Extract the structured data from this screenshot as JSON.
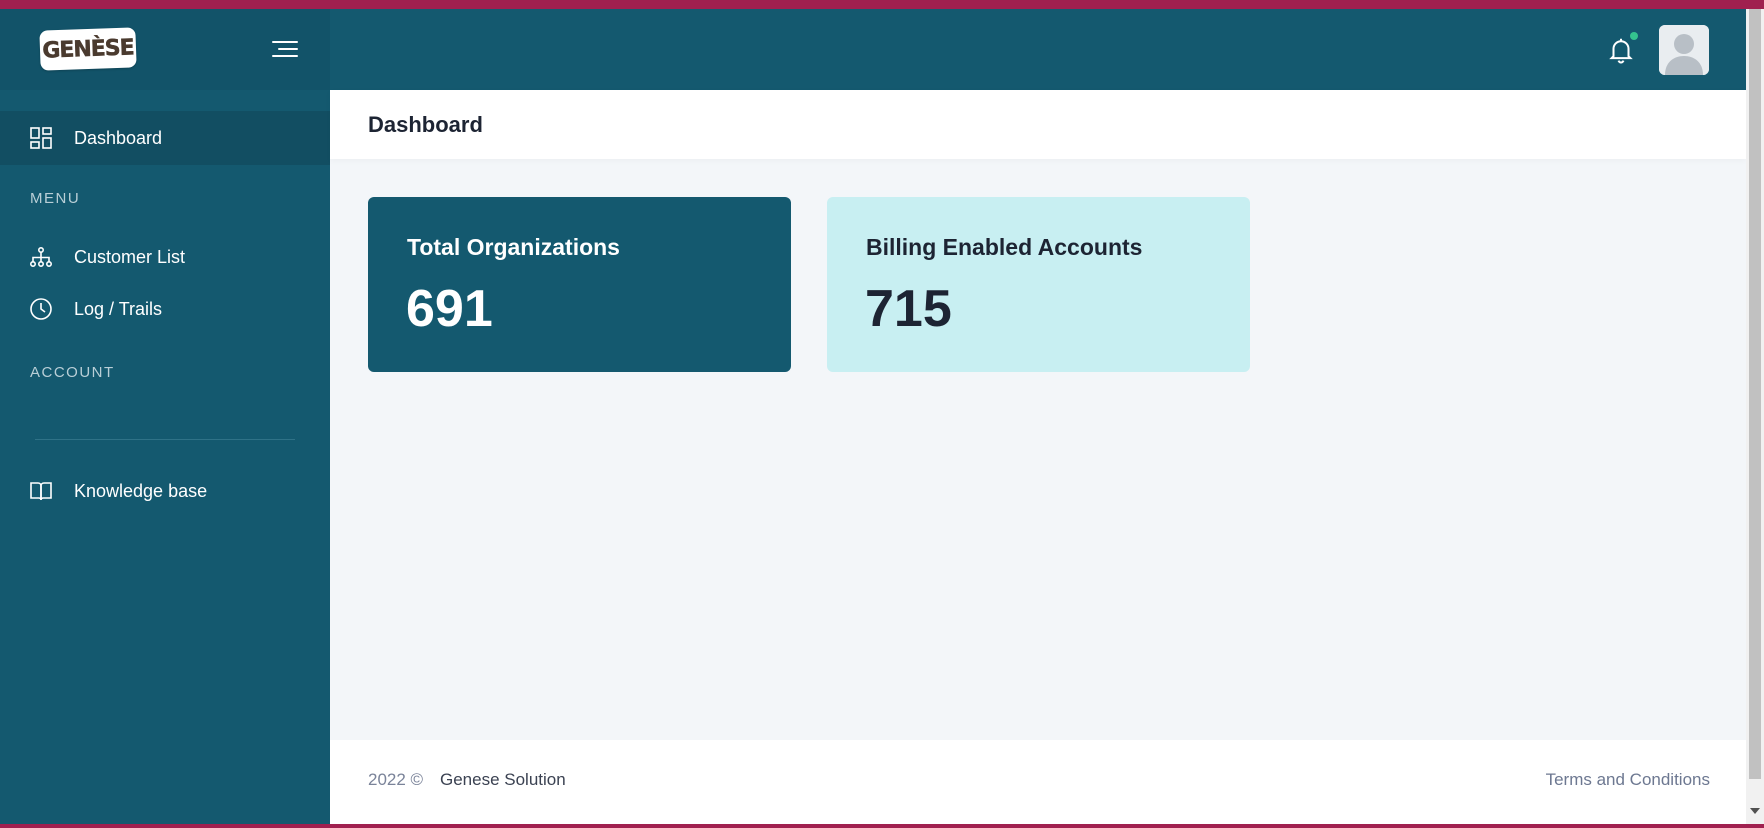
{
  "brand": {
    "logo_text": "GENÈSE"
  },
  "sidebar": {
    "active_item": {
      "label": "Dashboard",
      "icon": "dashboard-grid-icon"
    },
    "menu_title": "MENU",
    "menu_items": [
      {
        "label": "Customer List",
        "icon": "sitemap-icon"
      },
      {
        "label": "Log / Trails",
        "icon": "clock-icon"
      }
    ],
    "account_title": "ACCOUNT",
    "extra_items": [
      {
        "label": "Knowledge base",
        "icon": "book-icon"
      }
    ]
  },
  "header": {
    "notification_icon": "bell-icon",
    "notification_dot_color": "#34c38f",
    "avatar_icon": "user-avatar-icon"
  },
  "page": {
    "title": "Dashboard"
  },
  "cards": [
    {
      "title": "Total Organizations",
      "value": "691",
      "bg": "#14596f"
    },
    {
      "title": "Billing Enabled Accounts",
      "value": "715",
      "bg": "#c8eff2"
    }
  ],
  "footer": {
    "year": "2022 ©",
    "company": "Genese Solution",
    "terms": "Terms and Conditions"
  },
  "colors": {
    "sidebar": "#14596f",
    "window_frame": "#a0204f",
    "content_bg": "#f3f6f9"
  }
}
